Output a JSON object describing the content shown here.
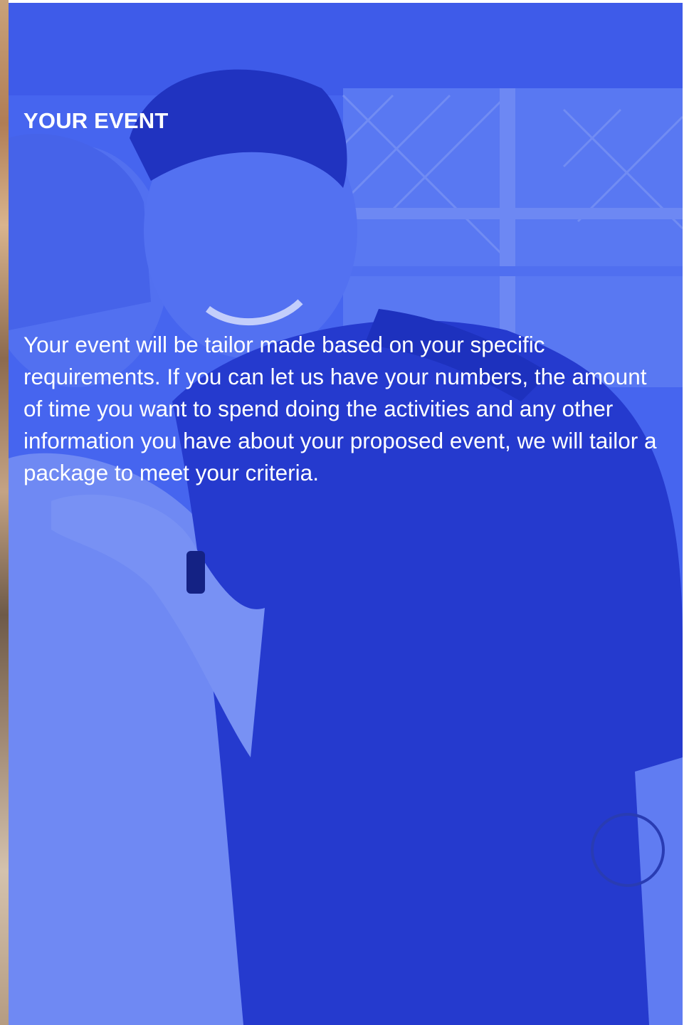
{
  "panel": {
    "title": "YOUR EVENT",
    "body": "Your event will be tailor made based on your specific requirements. If you can let us have your numbers, the amount of time you want to spend doing the activities and any other information you have about your proposed event, we will tailor a package to meet your criteria."
  },
  "colors": {
    "overlay_blue": "#4466ee",
    "text": "#ffffff"
  },
  "background_image": "photo-of-two-people"
}
